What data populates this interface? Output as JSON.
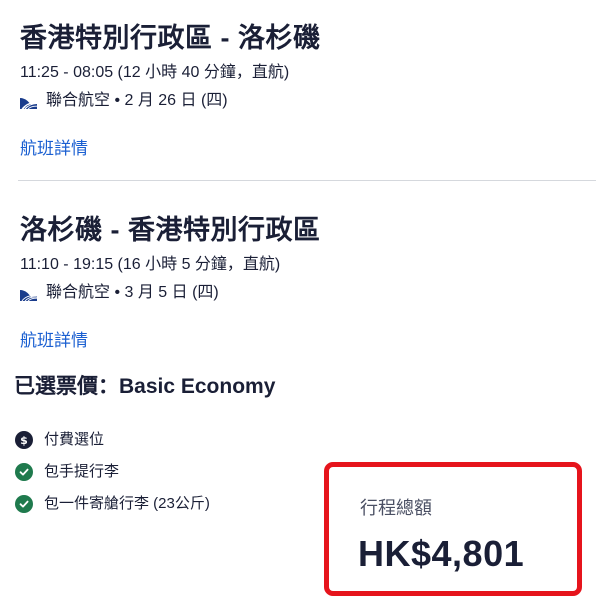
{
  "outbound": {
    "title": "香港特別行政區 - 洛杉磯",
    "times": "11:25 - 08:05 (12 小時 40 分鐘，直航)",
    "airline_date": "聯合航空 • 2 月 26 日 (四)",
    "details_link": "航班詳情"
  },
  "return": {
    "title": "洛杉磯 - 香港特別行政區",
    "times": "11:10 - 19:15 (16 小時 5 分鐘，直航)",
    "airline_date": "聯合航空 • 3 月 5 日 (四)",
    "details_link": "航班詳情"
  },
  "fare": {
    "heading": "已選票價：Basic Economy",
    "features": [
      {
        "label": "付費選位",
        "icon": "dollar-icon"
      },
      {
        "label": "包手提行李",
        "icon": "check-icon"
      },
      {
        "label": "包一件寄艙行李 (23公斤)",
        "icon": "check-icon"
      }
    ]
  },
  "total": {
    "label": "行程總額",
    "amount": "HK$4,801"
  },
  "colors": {
    "link": "#1a5fd1",
    "highlight_border": "#e6141c",
    "check": "#1f7a4d",
    "text": "#1a1f36",
    "airline_logo": "#1a3c8c"
  }
}
